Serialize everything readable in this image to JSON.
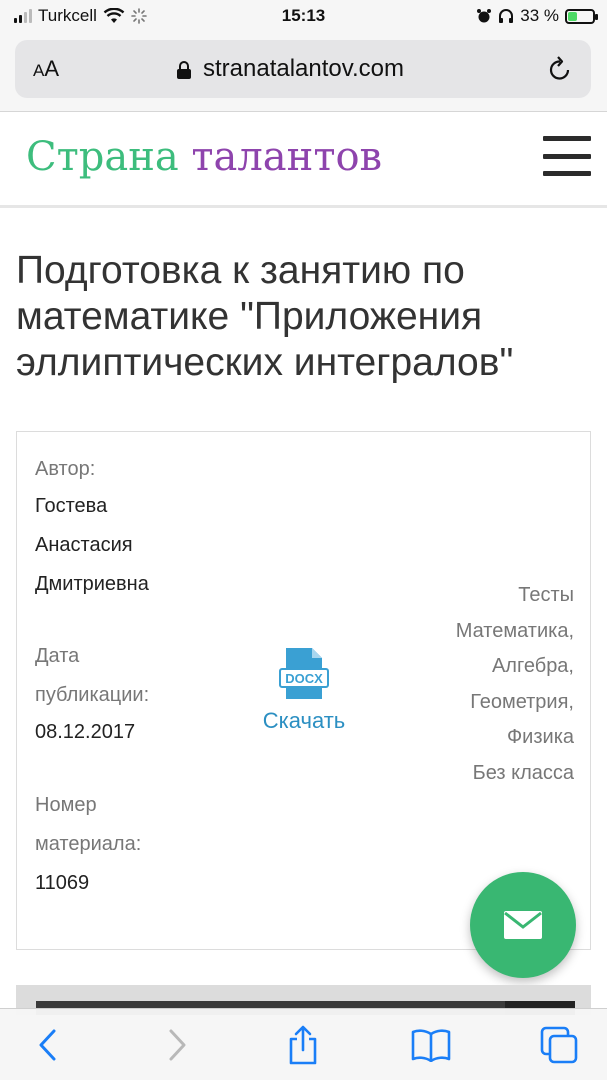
{
  "status_bar": {
    "carrier": "Turkcell",
    "time": "15:13",
    "battery_percent_label": "33 %",
    "battery_level": 0.33
  },
  "browser": {
    "text_size_label": "AA",
    "url": "stranatalantov.com"
  },
  "site": {
    "logo_part1": "Страна",
    "logo_part2": "талантов",
    "colors": {
      "logo_green": "#3dbd7d",
      "logo_purple": "#8e44ad",
      "link_blue": "#2b8fc2",
      "fab_green": "#39b772"
    }
  },
  "article": {
    "title": "Подготовка к занятию по математике \"Приложения эллиптических интегралов\"",
    "author_label": "Автор:",
    "author_lines": [
      "Гостева",
      "Анастасия",
      "Дмитриевна"
    ],
    "date_label_lines": [
      "Дата",
      "публикации:"
    ],
    "date_value": "08.12.2017",
    "number_label_lines": [
      "Номер",
      "материала:"
    ],
    "number_value": "11069",
    "file_type": "DOCX",
    "download_label": "Скачать",
    "tags": [
      "Тесты",
      "Математика,",
      "Алгебра,",
      "Геометрия,",
      "Физика",
      "Без класса"
    ]
  },
  "icons": {
    "lock": "lock-icon",
    "reload": "reload-icon",
    "menu": "hamburger-menu-icon",
    "docx": "docx-file-icon",
    "mail": "mail-icon",
    "back": "chevron-left-icon",
    "forward": "chevron-right-icon",
    "share": "share-icon",
    "bookmarks": "book-icon",
    "tabs": "tabs-icon"
  }
}
